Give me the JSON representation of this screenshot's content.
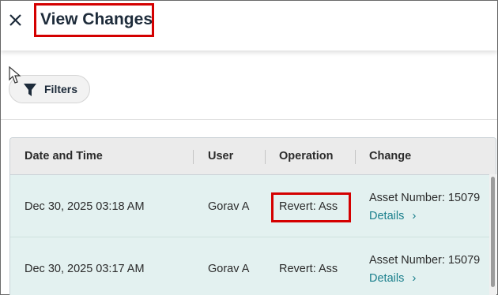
{
  "header": {
    "title": "View Changes"
  },
  "toolbar": {
    "filters_label": "Filters"
  },
  "table": {
    "columns": [
      "Date and Time",
      "User",
      "Operation",
      "Change"
    ],
    "rows": [
      {
        "datetime": "Dec 30, 2025 03:18 AM",
        "user": "Gorav A",
        "operation": "Revert: Ass",
        "change": "Asset Number: 15079",
        "details": "Details"
      },
      {
        "datetime": "Dec 30, 2025 03:17 AM",
        "user": "Gorav A",
        "operation": "Revert: Ass",
        "change": "Asset Number: 15079",
        "details": "Details"
      }
    ]
  },
  "colors": {
    "accent": "#1a7f8c",
    "row_bg": "#e3f1f0",
    "highlight": "#d40000",
    "title": "#1d2b3a"
  },
  "icons": [
    "close-icon",
    "filter-icon",
    "chevron-right-icon",
    "mouse-cursor-icon"
  ]
}
